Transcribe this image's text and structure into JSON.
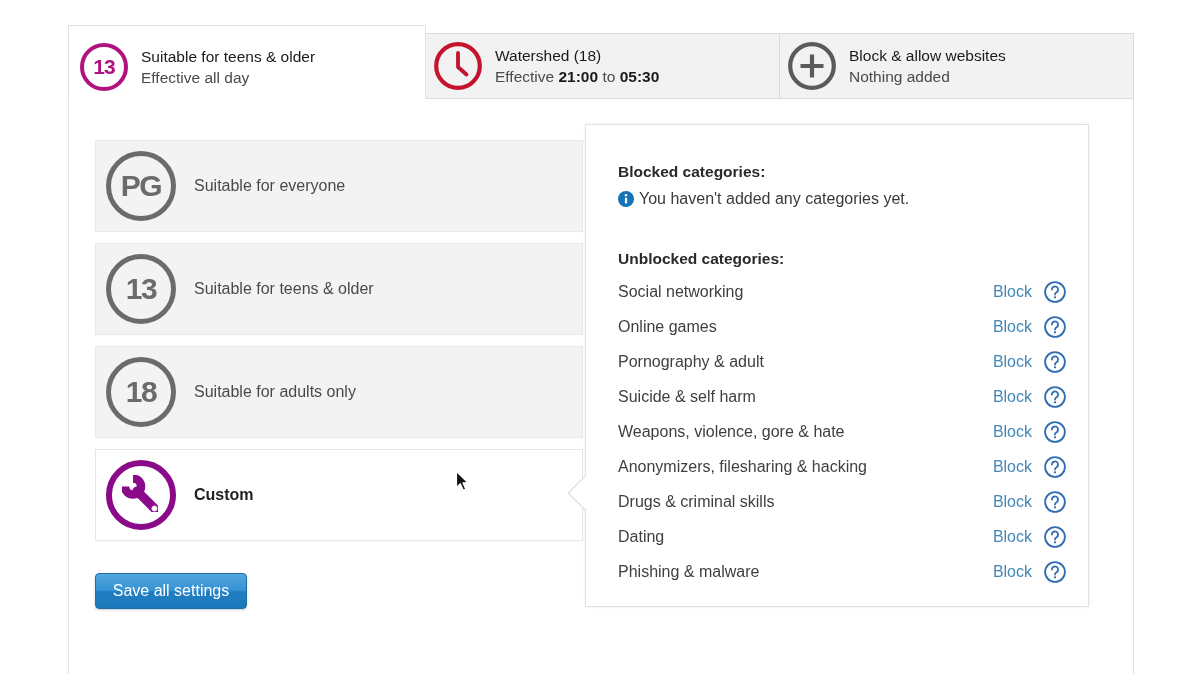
{
  "tabs": [
    {
      "kind": "rating",
      "badge": "13",
      "color": "#b0127e",
      "title": "Suitable for teens & older",
      "subtitle": "Effective all day",
      "selected": true
    },
    {
      "kind": "schedule",
      "color": "#c3142d",
      "title": "Watershed (18)",
      "subtitle": "Effective **21:00** to **05:30**",
      "selected": false
    },
    {
      "kind": "add",
      "color": "#5a5a5a",
      "title": "Block & allow websites",
      "subtitle": "Nothing added",
      "selected": false
    }
  ],
  "ratings": [
    {
      "kind": "rating",
      "badge": "PG",
      "label": "Suitable for everyone",
      "selected": false
    },
    {
      "kind": "rating",
      "badge": "13",
      "label": "Suitable for teens & older",
      "selected": false
    },
    {
      "kind": "rating",
      "badge": "18",
      "label": "Suitable for adults only",
      "selected": false
    },
    {
      "kind": "custom",
      "label": "Custom",
      "selected": true
    }
  ],
  "save_button": "Save all settings",
  "categories_panel": {
    "blocked_heading": "Blocked categories:",
    "blocked_message": "You haven't added any categories yet.",
    "unblocked_heading": "Unblocked categories:",
    "unblocked": [
      {
        "name": "Social networking",
        "action": "Block"
      },
      {
        "name": "Online games",
        "action": "Block"
      },
      {
        "name": "Pornography & adult",
        "action": "Block"
      },
      {
        "name": "Suicide & self harm",
        "action": "Block"
      },
      {
        "name": "Weapons, violence, gore & hate",
        "action": "Block"
      },
      {
        "name": "Anonymizers, filesharing & hacking",
        "action": "Block"
      },
      {
        "name": "Drugs & criminal skills",
        "action": "Block"
      },
      {
        "name": "Dating",
        "action": "Block"
      },
      {
        "name": "Phishing & malware",
        "action": "Block"
      }
    ]
  }
}
